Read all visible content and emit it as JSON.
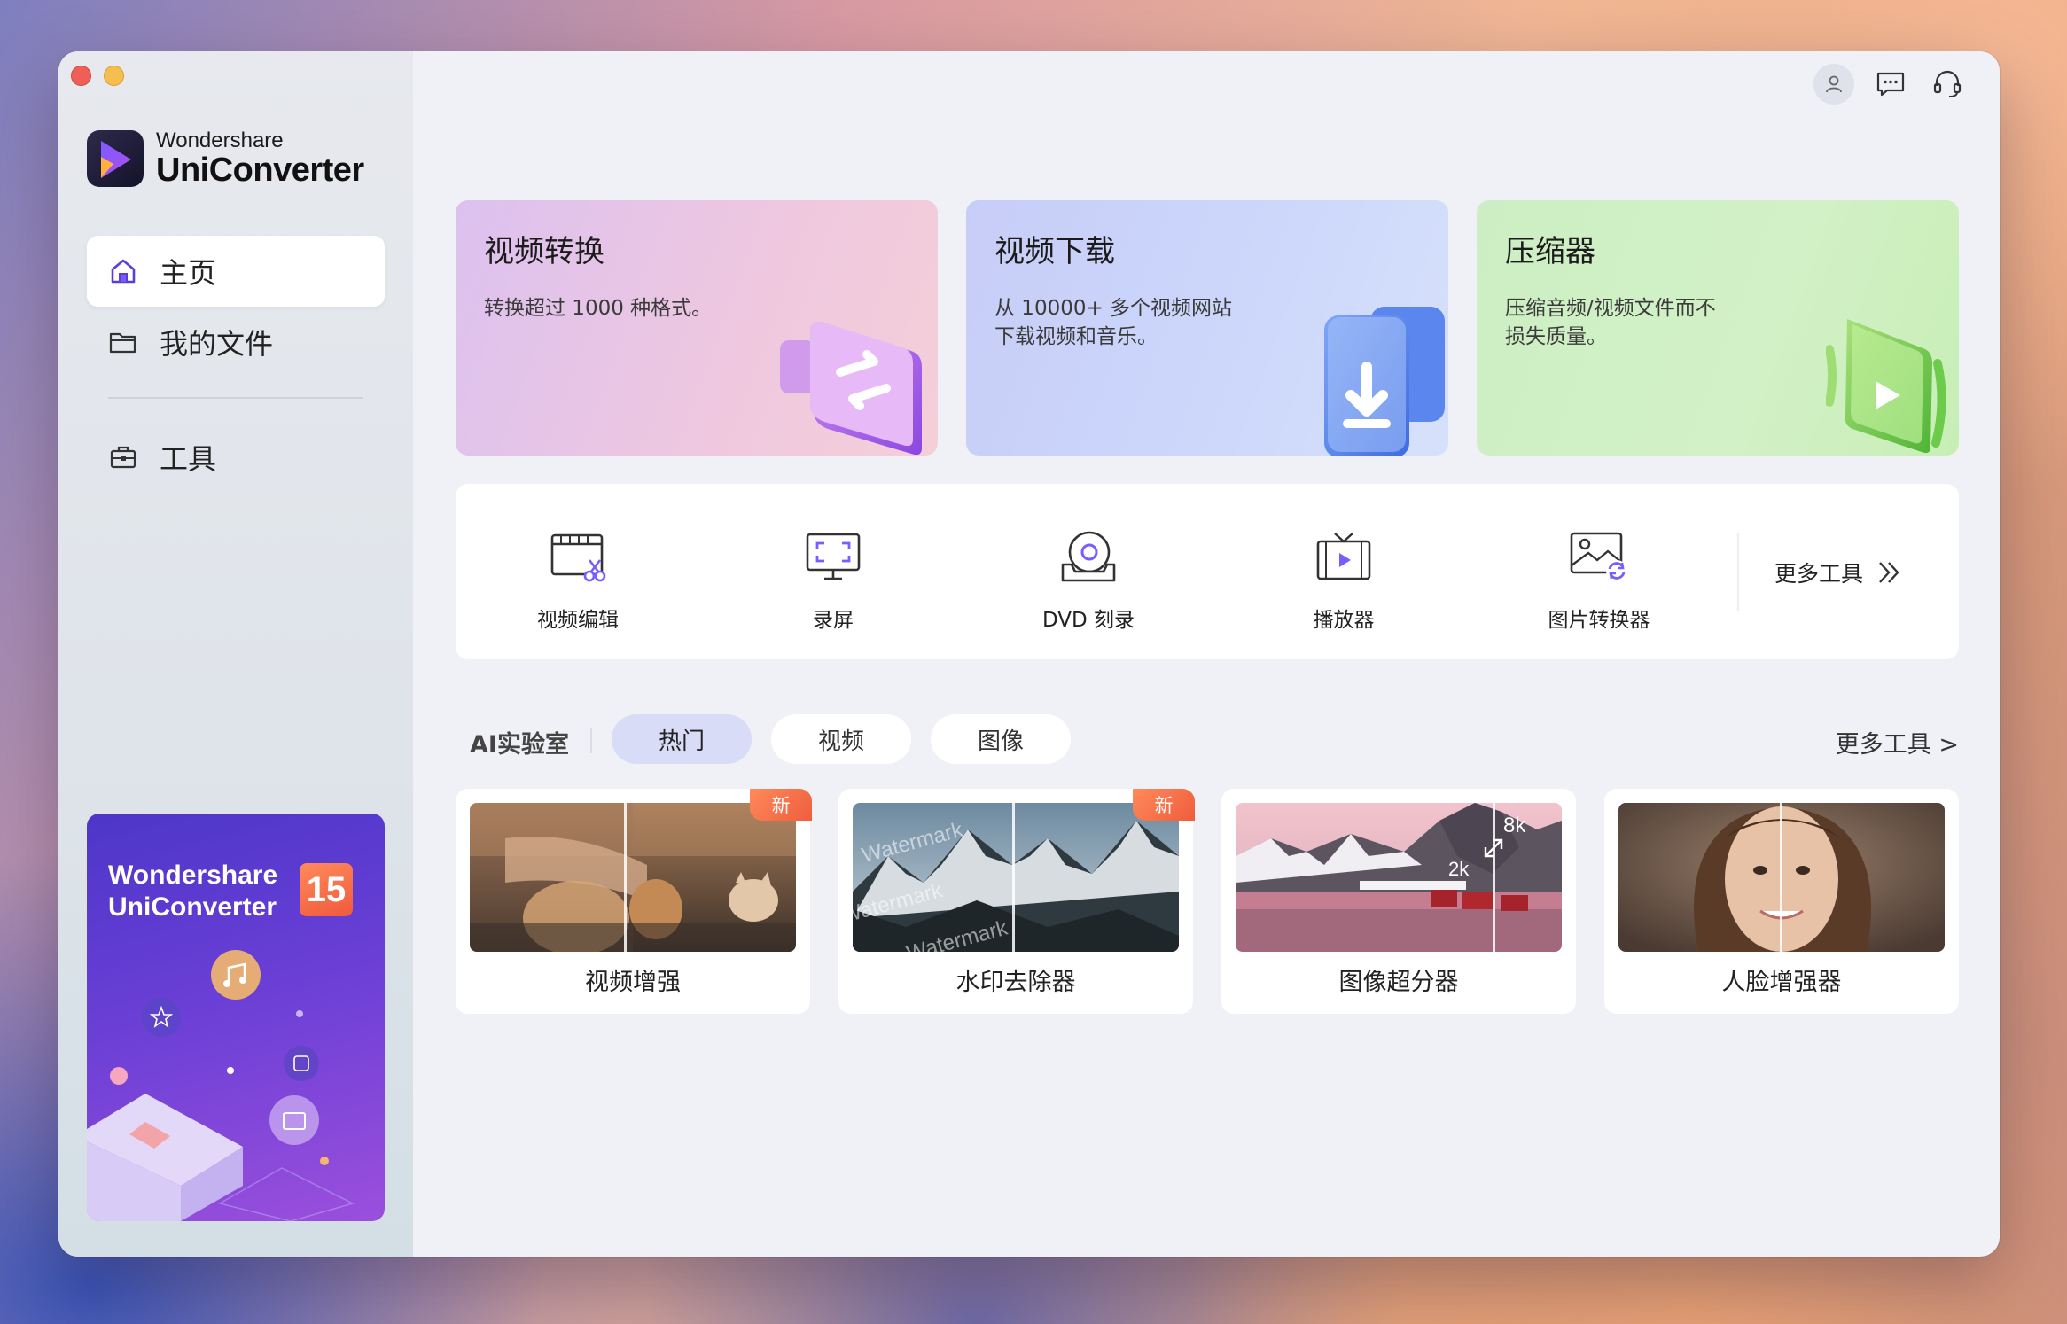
{
  "brand": {
    "company": "Wondershare",
    "product": "UniConverter"
  },
  "nav": {
    "home": "主页",
    "files": "我的文件",
    "tools": "工具"
  },
  "promo": {
    "line1": "Wondershare",
    "line2": "UniConverter",
    "version": "15"
  },
  "cards": [
    {
      "title": "视频转换",
      "desc": "转换超过 1000 种格式。"
    },
    {
      "title": "视频下载",
      "desc_line1": "从 10000+ 多个视频网站",
      "desc_line2": "下载视频和音乐。"
    },
    {
      "title": "压缩器",
      "desc_line1": "压缩音频/视频文件而不",
      "desc_line2": "损失质量。"
    }
  ],
  "tools": [
    {
      "label": "视频编辑",
      "icon": "video-edit-icon"
    },
    {
      "label": "录屏",
      "icon": "screen-record-icon"
    },
    {
      "label": "DVD 刻录",
      "icon": "dvd-burn-icon"
    },
    {
      "label": "播放器",
      "icon": "player-icon"
    },
    {
      "label": "图片转换器",
      "icon": "image-convert-icon"
    }
  ],
  "more_tools_label": "更多工具",
  "ai_lab": {
    "title": "AI实验室",
    "tabs": [
      "热门",
      "视频",
      "图像"
    ],
    "more": "更多工具 >",
    "cards": [
      {
        "label": "视频增强",
        "badge": "新"
      },
      {
        "label": "水印去除器",
        "badge": "新",
        "watermark_text": "Watermark"
      },
      {
        "label": "图像超分器",
        "res_high": "8k",
        "res_low": "2k"
      },
      {
        "label": "人脸增强器"
      }
    ]
  },
  "colors": {
    "accent": "#7b4fe0",
    "badge": "#ef5d3d",
    "active_tab": "#d8dcf7"
  }
}
